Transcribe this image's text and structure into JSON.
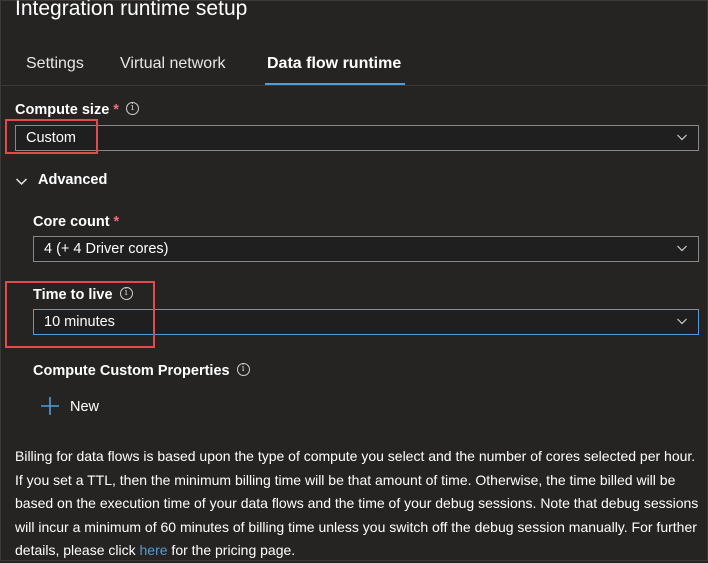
{
  "header": {
    "title": "Integration runtime setup"
  },
  "tabs": [
    {
      "label": "Settings",
      "active": false
    },
    {
      "label": "Virtual network",
      "active": false
    },
    {
      "label": "Data flow runtime",
      "active": true
    }
  ],
  "compute_size": {
    "label": "Compute size",
    "required_mark": "*",
    "value": "Custom"
  },
  "advanced": {
    "label": "Advanced",
    "expanded": true
  },
  "core_count": {
    "label": "Core count",
    "required_mark": "*",
    "value": "4 (+ 4 Driver cores)"
  },
  "time_to_live": {
    "label": "Time to live",
    "value": "10 minutes"
  },
  "custom_properties": {
    "label": "Compute Custom Properties",
    "new_label": "New"
  },
  "billing": {
    "text_before_link": "Billing for data flows is based upon the type of compute you select and the number of cores selected per hour. If you set a TTL, then the minimum billing time will be that amount of time. Otherwise, the time billed will be based on the execution time of your data flows and the time of your debug sessions. Note that debug sessions will incur a minimum of 60 minutes of billing time unless you switch off the debug session manually. For further details, please click ",
    "link_text": "here",
    "text_after_link": " for the pricing page."
  },
  "colors": {
    "background": "#252423",
    "accent": "#4f9dd9",
    "required": "#f1707b",
    "highlight_box": "#e04b4b"
  },
  "icons": {
    "info": "info-icon",
    "dropdown": "chevron-down-icon",
    "add": "plus-icon"
  }
}
